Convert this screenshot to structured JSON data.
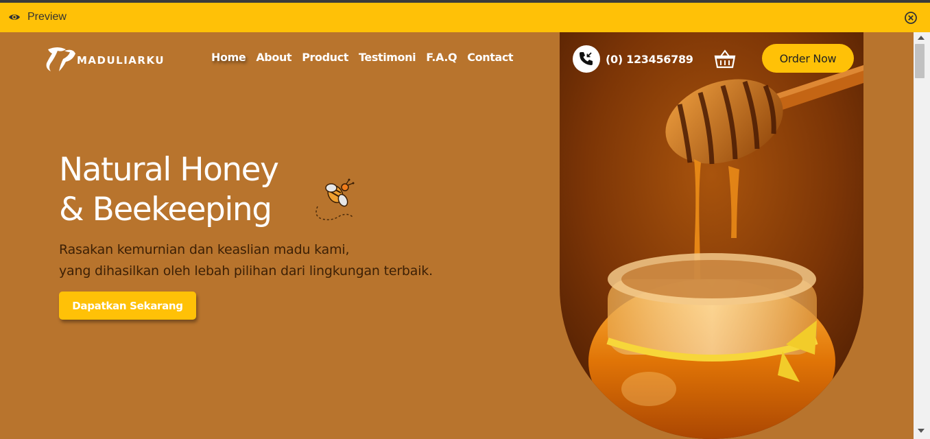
{
  "preview_bar": {
    "label": "Preview",
    "eye_icon": "eye-icon",
    "close_icon": "close-circle-icon",
    "color": "#ffc107"
  },
  "brand": {
    "name": "MADULIARKU",
    "logo_icon": "bee-logo-icon"
  },
  "nav": {
    "items": [
      {
        "label": "Home",
        "active": true
      },
      {
        "label": "About"
      },
      {
        "label": "Product"
      },
      {
        "label": "Testimoni"
      },
      {
        "label": "F.A.Q"
      },
      {
        "label": "Contact"
      }
    ]
  },
  "contact": {
    "phone": "(0) 123456789",
    "phone_icon": "phone-incoming-icon"
  },
  "cart_icon": "basket-icon",
  "order_button": "Order Now",
  "hero": {
    "title_line1": "Natural Honey",
    "title_line2": "& Beekeeping",
    "subtitle_line1": "Rasakan kemurnian dan keaslian madu kami,",
    "subtitle_line2": "yang dihasilkan oleh lebah pilihan dari lingkungan terbaik.",
    "cta": "Dapatkan Sekarang",
    "bee_icon": "bee-icon",
    "image": "honey-jar-dipper-photo"
  },
  "colors": {
    "background": "#b8742d",
    "accent": "#ffc107",
    "subtitle_text": "#3d2005"
  }
}
